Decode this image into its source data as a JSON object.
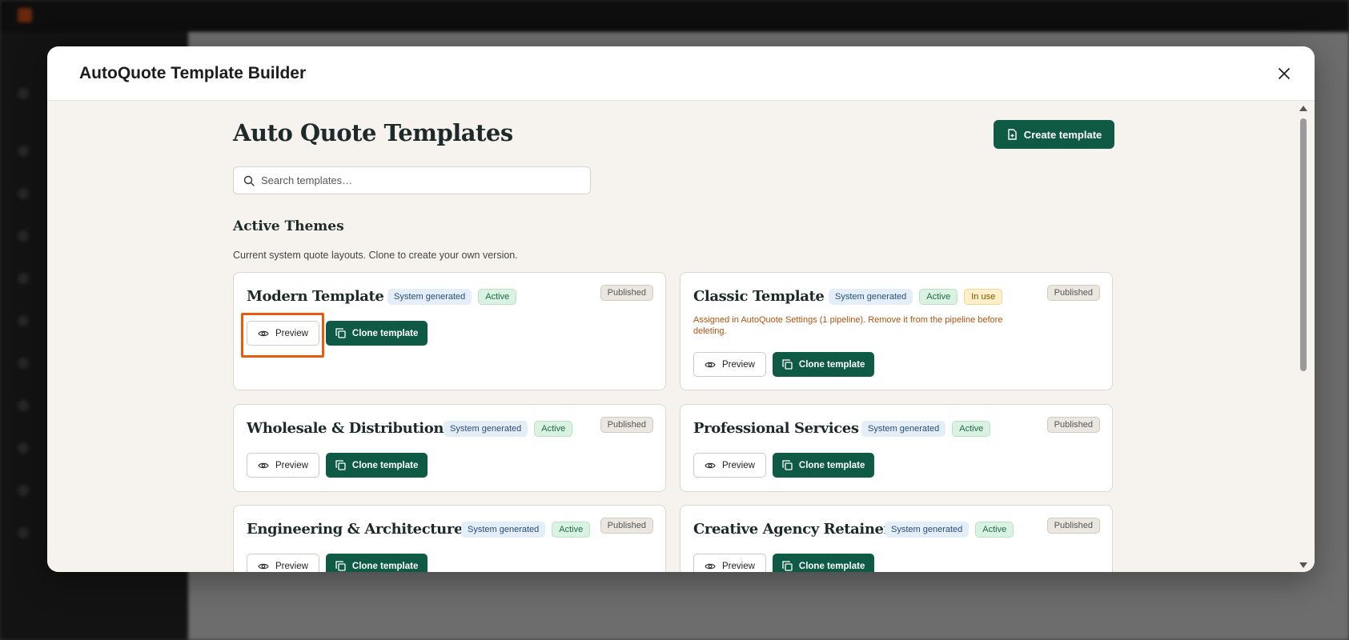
{
  "modal": {
    "title": "AutoQuote Template Builder",
    "close_icon": "close-icon"
  },
  "page": {
    "title": "Auto Quote Templates",
    "create_button": "Create template",
    "search_placeholder": "Search templates…"
  },
  "section": {
    "title": "Active Themes",
    "description": "Current system quote layouts. Clone to create your own version."
  },
  "cards": [
    {
      "name": "Modern Template",
      "badges": [
        "System generated",
        "Active"
      ],
      "status": "Published",
      "preview": "Preview",
      "clone": "Clone template"
    },
    {
      "name": "Classic Template",
      "badges": [
        "System generated",
        "Active",
        "In use"
      ],
      "status": "Published",
      "warning": "Assigned in AutoQuote Settings (1 pipeline). Remove it from the pipeline before deleting.",
      "preview": "Preview",
      "clone": "Clone template"
    },
    {
      "name": "Wholesale & Distribution",
      "badges": [
        "System generated",
        "Active"
      ],
      "status": "Published",
      "preview": "Preview",
      "clone": "Clone template"
    },
    {
      "name": "Professional Services",
      "badges": [
        "System generated",
        "Active"
      ],
      "status": "Published",
      "preview": "Preview",
      "clone": "Clone template"
    },
    {
      "name": "Engineering & Architecture",
      "badges": [
        "System generated",
        "Active"
      ],
      "status": "Published",
      "preview": "Preview",
      "clone": "Clone template"
    },
    {
      "name": "Creative Agency Retainer",
      "badges": [
        "System generated",
        "Active"
      ],
      "status": "Published",
      "preview": "Preview",
      "clone": "Clone template"
    }
  ],
  "colors": {
    "primary": "#0f5a45",
    "highlight": "#ea5a0c",
    "warning_text": "#b3520d"
  }
}
